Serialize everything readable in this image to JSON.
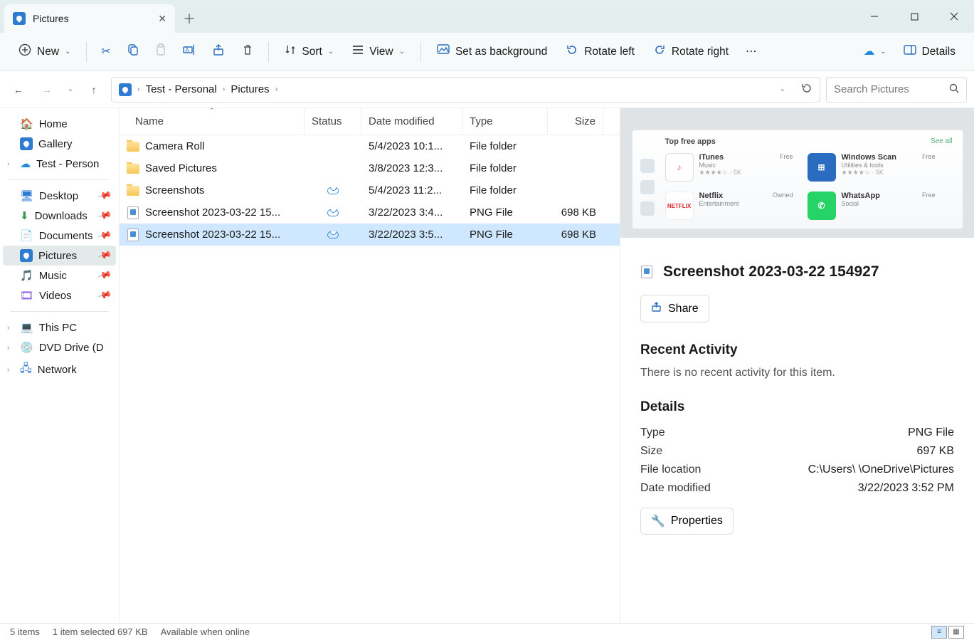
{
  "tab": {
    "title": "Pictures"
  },
  "toolbar": {
    "new": "New",
    "sort": "Sort",
    "view": "View",
    "setbg": "Set as background",
    "rotleft": "Rotate left",
    "rotright": "Rotate right",
    "details": "Details"
  },
  "breadcrumb": {
    "root": "Test - Personal",
    "current": "Pictures"
  },
  "search": {
    "placeholder": "Search Pictures"
  },
  "sidebar": {
    "home": "Home",
    "gallery": "Gallery",
    "personal": "Test - Person",
    "desktop": "Desktop",
    "downloads": "Downloads",
    "documents": "Documents",
    "pictures": "Pictures",
    "music": "Music",
    "videos": "Videos",
    "thispc": "This PC",
    "dvd": "DVD Drive (D",
    "network": "Network"
  },
  "columns": {
    "name": "Name",
    "status": "Status",
    "date": "Date modified",
    "type": "Type",
    "size": "Size"
  },
  "files": [
    {
      "name": "Camera Roll",
      "status": "",
      "date": "5/4/2023 10:1...",
      "type": "File folder",
      "size": "",
      "icon": "folder"
    },
    {
      "name": "Saved Pictures",
      "status": "",
      "date": "3/8/2023 12:3...",
      "type": "File folder",
      "size": "",
      "icon": "folder"
    },
    {
      "name": "Screenshots",
      "status": "cloud",
      "date": "5/4/2023 11:2...",
      "type": "File folder",
      "size": "",
      "icon": "folder"
    },
    {
      "name": "Screenshot 2023-03-22 15...",
      "status": "cloud",
      "date": "3/22/2023 3:4...",
      "type": "PNG File",
      "size": "698 KB",
      "icon": "file"
    },
    {
      "name": "Screenshot 2023-03-22 15...",
      "status": "cloud",
      "date": "3/22/2023 3:5...",
      "type": "PNG File",
      "size": "698 KB",
      "icon": "file",
      "selected": true
    }
  ],
  "preview": {
    "title": "Screenshot 2023-03-22 154927",
    "share": "Share",
    "sample": {
      "header": "Top free apps",
      "seeall": "See all",
      "t1": {
        "name": "iTunes",
        "sub": "Music",
        "meta": "★★★★☆ · 5K",
        "badge": "Free"
      },
      "t2": {
        "name": "Windows Scan",
        "sub": "Utilities & tools",
        "meta": "★★★★☆ · 5K",
        "badge": "Free"
      },
      "t3": {
        "name": "Netflix",
        "sub": "Entertainment",
        "meta": "",
        "badge": "Owned"
      },
      "t4": {
        "name": "WhatsApp",
        "sub": "Social",
        "meta": "",
        "badge": "Free"
      }
    },
    "recent_h": "Recent Activity",
    "recent_empty": "There is no recent activity for this item.",
    "details_h": "Details",
    "rows": {
      "type_k": "Type",
      "type_v": "PNG File",
      "size_k": "Size",
      "size_v": "697 KB",
      "loc_k": "File location",
      "loc_v": "C:\\Users\\     \\OneDrive\\Pictures",
      "mod_k": "Date modified",
      "mod_v": "3/22/2023 3:52 PM"
    },
    "properties": "Properties"
  },
  "statusbar": {
    "count": "5 items",
    "selected": "1 item selected  697 KB",
    "avail": "Available when online"
  }
}
